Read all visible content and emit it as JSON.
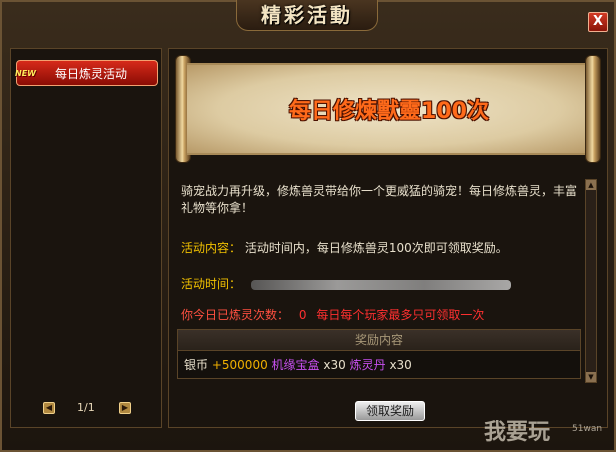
{
  "window": {
    "title": "精彩活動",
    "close_label": "X"
  },
  "sidebar": {
    "items": [
      {
        "label": "每日炼灵活动",
        "badge": "NEW"
      }
    ],
    "pager": {
      "text": "1/1"
    }
  },
  "scroll": {
    "heading": "每日修煉獸靈100次"
  },
  "detail": {
    "description": "骑宠战力再升级，修炼兽灵带给你一个更威猛的骑宠！每日修炼兽灵，丰富礼物等你拿！",
    "content_label": "活动内容：",
    "content_value": "活动时间内，每日修炼兽灵100次即可领取奖励。",
    "time_label": "活动时间：",
    "count_label": "你今日已炼灵次数：",
    "count_value": "0",
    "count_note": "每日每个玩家最多只可领取一次"
  },
  "rewards": {
    "header": "奖励内容",
    "items": [
      {
        "name": "银币",
        "amount": "+500000"
      },
      {
        "name": "机缘宝盒",
        "amount": "x30"
      },
      {
        "name": "炼灵丹",
        "amount": "x30"
      }
    ]
  },
  "actions": {
    "claim_label": "领取奖励"
  },
  "watermark": {
    "text": "我要玩",
    "site": "51wan"
  }
}
